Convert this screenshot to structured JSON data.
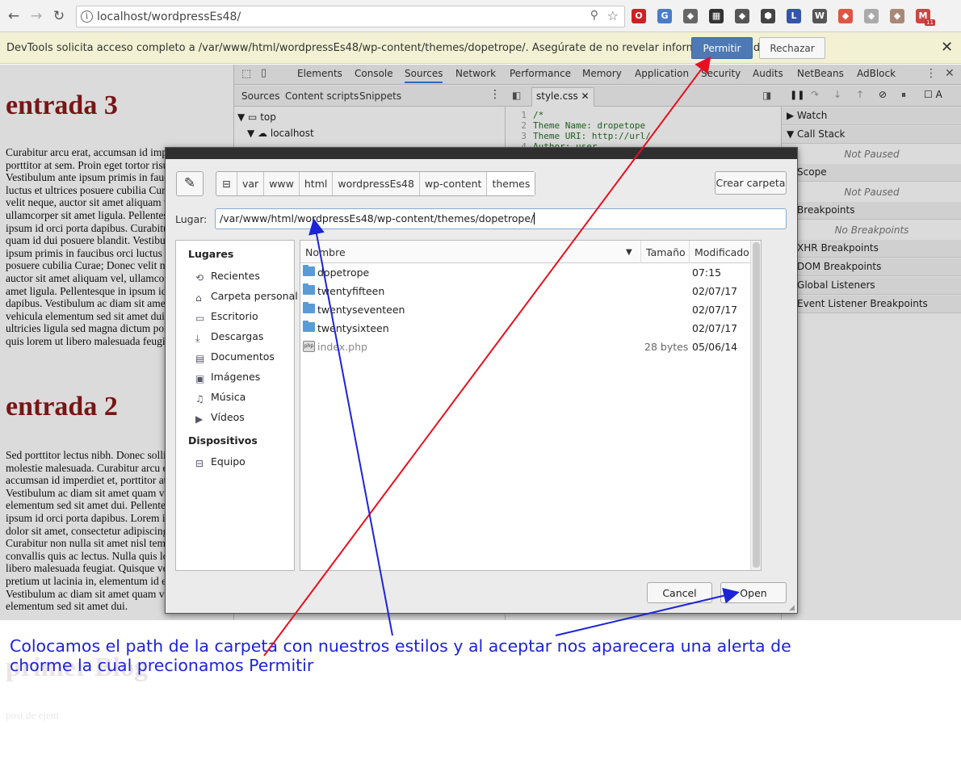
{
  "browser": {
    "url": "localhost/wordpressEs48/",
    "extensions": [
      "opera-icon",
      "translate-icon",
      "extension-icon",
      "film-icon",
      "extension-icon",
      "cube-icon",
      "li-icon",
      "wordpress-icon",
      "extension-icon",
      "extension-icon",
      "extension-icon",
      "gmail-icon"
    ],
    "gmail_badge": "11"
  },
  "infobar": {
    "message": "DevTools solicita acceso completo a /var/www/html/wordpressEs48/wp-content/themes/dopetrope/. Asegúrate de no revelar información confidencial.",
    "allow_label": "Permitir",
    "deny_label": "Rechazar"
  },
  "page": {
    "post1_title": "entrada 3",
    "post1_lines": [
      "Curabitur arcu erat, accumsan id imperdiet et,",
      "porttitor at sem. Proin eget tortor risus. Proin",
      "Vestibulum ante ipsum primis in faucibus orci",
      "luctus et ultrices posuere cubilia Curae; Donec",
      "velit neque, auctor sit amet aliquam vel,",
      "ullamcorper sit amet ligula. Pellentesque in",
      "ipsum id orci porta dapibus. Curabitur aliquet",
      "quam id dui posuere blandit. Vestibulum ante",
      "ipsum primis in faucibus orci luctus et ultrices",
      "posuere cubilia Curae; Donec velit neque,",
      "auctor sit amet aliquam vel, ullamcorper sit",
      "amet ligula. Pellentesque in ipsum id orci porta",
      "dapibus. Vestibulum ac diam sit amet quam",
      "vehicula elementum sed sit amet dui. Nulla",
      "ultricies ligula sed magna dictum porta. Nulla",
      "quis lorem ut libero malesuada feugiat."
    ],
    "post2_title": "entrada 2",
    "post2_lines": [
      "Sed porttitor lectus nibh. Donec sollicitudin",
      "molestie malesuada. Curabitur arcu erat,",
      "accumsan id imperdiet et, porttitor at sem.",
      "Vestibulum ac diam sit amet quam vehicula",
      "elementum sed sit amet dui. Pellentesque in",
      "ipsum id orci porta dapibus. Lorem ipsum",
      "dolor sit amet, consectetur adipiscing elit.",
      "Curabitur non nulla sit amet nisl tempus",
      "convallis quis ac lectus. Nulla quis lorem ut",
      "libero malesuada feugiat. Quisque velit nisi,",
      "pretium ut lacinia in, elementum id enim.",
      "Vestibulum ac diam sit amet quam vehicula",
      "elementum sed sit amet dui."
    ],
    "post3_title": "primer Blog",
    "post3_text": "post de ejem"
  },
  "devtools": {
    "tabs": [
      "Elements",
      "Console",
      "Sources",
      "Network",
      "Performance",
      "Memory",
      "Application",
      "Security",
      "Audits",
      "NetBeans",
      "AdBlock"
    ],
    "active_tab": "Sources",
    "nav_tabs": [
      "Sources",
      "Content scripts",
      "Snippets"
    ],
    "tree_top": "top",
    "tree_host": "localhost",
    "editor_file": "style.css",
    "code_lines": [
      {
        "n": "1",
        "t": "/*"
      },
      {
        "n": "2",
        "t": "Theme Name: dropetope"
      },
      {
        "n": "3",
        "t": "Theme URI: http://url/"
      },
      {
        "n": "4",
        "t": "Author: user"
      }
    ],
    "debug_sections": [
      {
        "label": "▶ Watch"
      },
      {
        "label": "▼ Call Stack",
        "note": "Not Paused"
      },
      {
        "label": "▼ Scope",
        "note": "Not Paused"
      },
      {
        "label": "▼ Breakpoints",
        "note": "No Breakpoints"
      },
      {
        "label": "▶ XHR Breakpoints"
      },
      {
        "label": "▶ DOM Breakpoints"
      },
      {
        "label": "▶ Global Listeners"
      },
      {
        "label": "▶ Event Listener Breakpoints"
      }
    ]
  },
  "dialog": {
    "breadcrumbs": [
      "var",
      "www",
      "html",
      "wordpressEs48",
      "wp-content",
      "themes"
    ],
    "new_folder_label": "Crear carpeta",
    "location_label": "Lugar:",
    "location_value": "/var/www/html/wordpressEs48/wp-content/themes/dopetrope/",
    "places_header": "Lugares",
    "places": [
      "Recientes",
      "Carpeta personal",
      "Escritorio",
      "Descargas",
      "Documentos",
      "Imágenes",
      "Música",
      "Vídeos"
    ],
    "devices_header": "Dispositivos",
    "devices": [
      "Equipo"
    ],
    "columns": {
      "name": "Nombre",
      "size": "Tamaño",
      "modified": "Modificado"
    },
    "files": [
      {
        "name": "dopetrope",
        "size": "",
        "modified": "07:15",
        "type": "folder"
      },
      {
        "name": "twentyfifteen",
        "size": "",
        "modified": "02/07/17",
        "type": "folder"
      },
      {
        "name": "twentyseventeen",
        "size": "",
        "modified": "02/07/17",
        "type": "folder"
      },
      {
        "name": "twentysixteen",
        "size": "",
        "modified": "02/07/17",
        "type": "folder"
      },
      {
        "name": "index.php",
        "size": "28 bytes",
        "modified": "05/06/14",
        "type": "php"
      }
    ],
    "cancel_label": "Cancel",
    "open_label": "Open"
  },
  "annotation": {
    "text": "Colocamos el path de la carpeta con nuestros estilos y al aceptar nos aparecera una alerta de chorme la cual precionamos Permitir",
    "colors": {
      "blue": "#1c24d8",
      "red": "#e8101e"
    }
  }
}
